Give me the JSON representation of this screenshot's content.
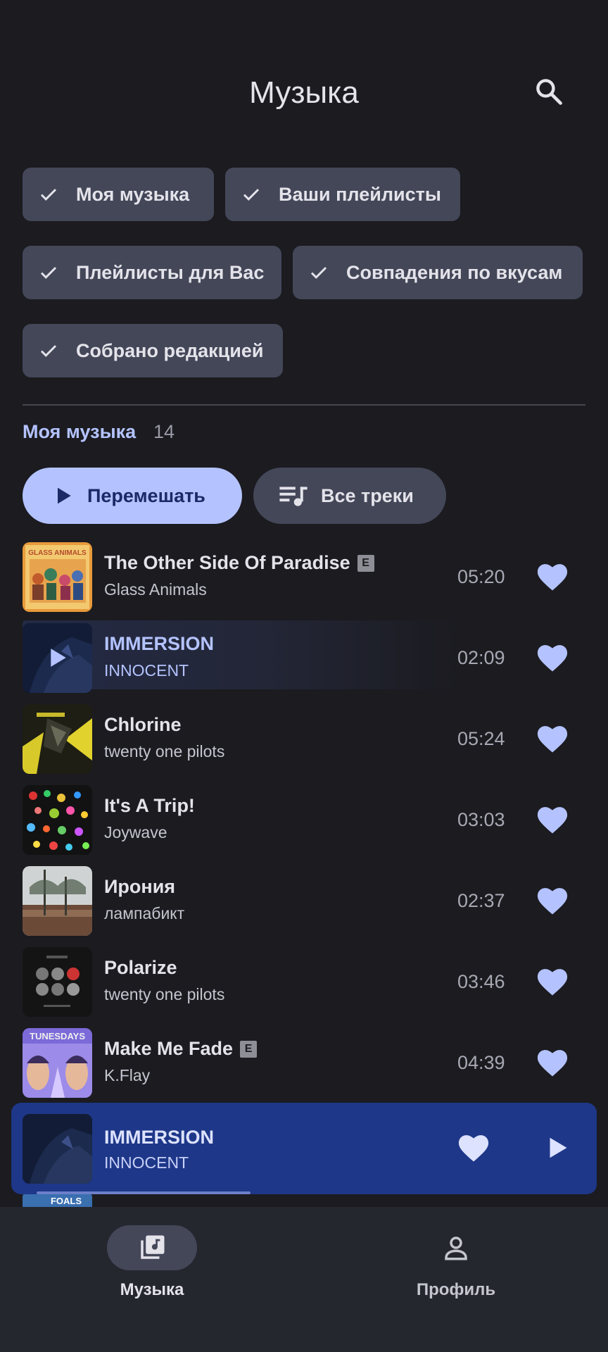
{
  "header": {
    "title": "Музыка",
    "search_icon": "search-icon"
  },
  "filters": [
    {
      "label": "Моя музыка",
      "selected": true
    },
    {
      "label": "Ваши плейлисты",
      "selected": true
    },
    {
      "label": "Плейлисты для Вас",
      "selected": true
    },
    {
      "label": "Совпадения по вкусам",
      "selected": true
    },
    {
      "label": "Собрано редакцией",
      "selected": true
    }
  ],
  "section": {
    "label": "Моя музыка",
    "count": "14"
  },
  "actions": {
    "shuffle_label": "Перемешать",
    "all_tracks_label": "Все треки"
  },
  "tracks": [
    {
      "title": "The Other Side Of Paradise",
      "artist": "Glass Animals",
      "duration": "05:20",
      "explicit": true,
      "liked": true
    },
    {
      "title": "IMMERSION",
      "artist": "INNOCENT",
      "duration": "02:09",
      "explicit": false,
      "liked": true,
      "playing": true
    },
    {
      "title": "Chlorine",
      "artist": "twenty one pilots",
      "duration": "05:24",
      "explicit": false,
      "liked": true
    },
    {
      "title": "It's A Trip!",
      "artist": "Joywave",
      "duration": "03:03",
      "explicit": false,
      "liked": true
    },
    {
      "title": "Ирония",
      "artist": "лампабикт",
      "duration": "02:37",
      "explicit": false,
      "liked": true
    },
    {
      "title": "Polarize",
      "artist": "twenty one pilots",
      "duration": "03:46",
      "explicit": false,
      "liked": true
    },
    {
      "title": "Make Me Fade",
      "artist": "K.Flay",
      "duration": "04:39",
      "explicit": true,
      "liked": true
    }
  ],
  "explicit_badge": "E",
  "cover_text": {
    "glass_animals": "GLASS ANIMALS",
    "tunesdays": "TUNESDAYS",
    "foals": "FOALS"
  },
  "now_playing": {
    "title": "IMMERSION",
    "artist": "INNOCENT",
    "progress": 0.4,
    "liked": true
  },
  "nav": [
    {
      "label": "Музыка",
      "icon": "music-library-icon",
      "active": true
    },
    {
      "label": "Профиль",
      "icon": "profile-icon",
      "active": false
    }
  ],
  "colors": {
    "background": "#1b1b20",
    "accent": "#b4c3ff",
    "chip": "#434758",
    "player": "#1e3788",
    "nav": "#25272f"
  }
}
